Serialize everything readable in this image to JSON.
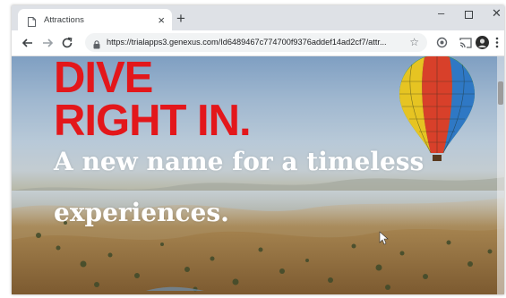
{
  "browser": {
    "tab": {
      "title": "Attractions"
    },
    "address_bar": {
      "url": "https://trialapps3.genexus.com/Id6489467c774700f9376addef14ad2cf7/attr..."
    }
  },
  "page": {
    "headline": [
      "DIVE",
      "RIGHT IN."
    ],
    "tagline": [
      "A new name for a timeless",
      "experiences."
    ],
    "colors": {
      "headline": "#e3171b",
      "tagline": "#ffffff"
    }
  },
  "icons": [
    "page-icon",
    "close-icon",
    "plus-icon",
    "minimize-icon",
    "maximize-icon",
    "window-close-icon",
    "back-arrow-icon",
    "forward-arrow-icon",
    "reload-icon",
    "lock-icon",
    "star-icon",
    "extension-icon",
    "cast-icon",
    "profile-avatar-icon",
    "more-menu-icon"
  ]
}
